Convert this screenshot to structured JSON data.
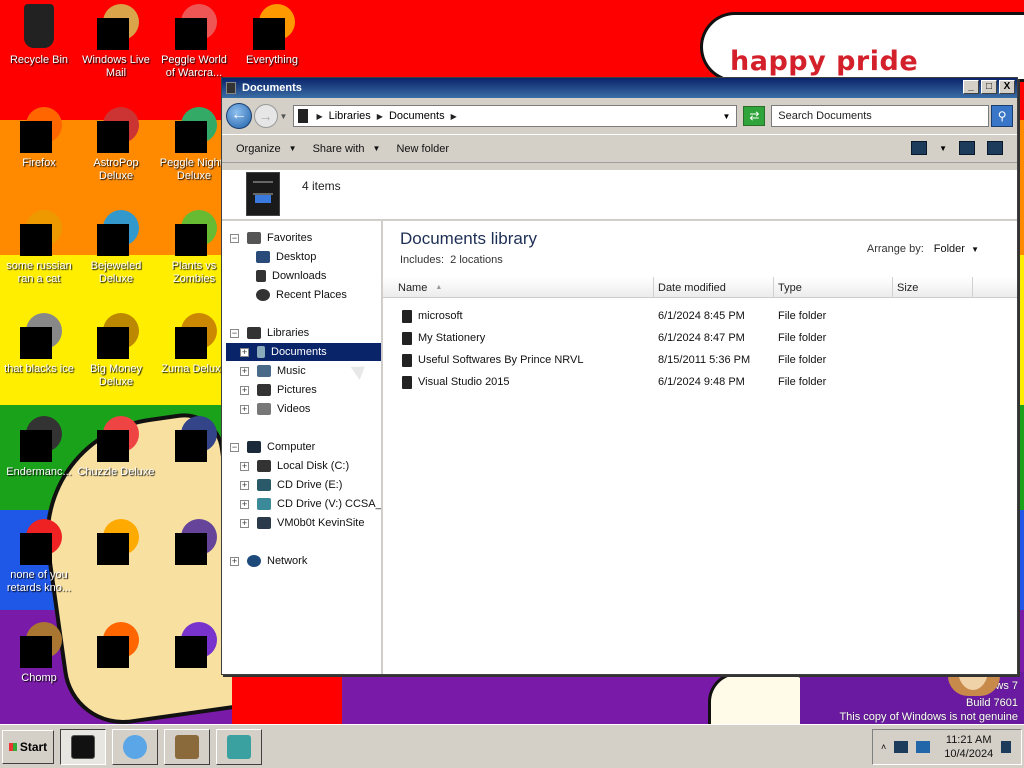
{
  "desktop": {
    "banner": "happy pride month",
    "watermark": {
      "line1": "ws 7",
      "line2": "Build 7601",
      "line3": "This copy of Windows is not genuine"
    },
    "stripe_colors": [
      "#ff0000",
      "#ff8a00",
      "#ffee00",
      "#1aa31a",
      "#1f57e6",
      "#7a1aa8"
    ],
    "icons": [
      {
        "label": "Recycle Bin",
        "icon": "recycle-bin-icon",
        "color": "#222"
      },
      {
        "label": "Windows Live Mail",
        "icon": "mail-icon",
        "color": "#d9a44a"
      },
      {
        "label": "Peggle World of Warcra...",
        "icon": "peggle-icon",
        "color": "#e55"
      },
      {
        "label": "Everything",
        "icon": "search-icon",
        "color": "#f90"
      },
      {
        "label": "Firefox",
        "icon": "firefox-icon",
        "color": "#f60"
      },
      {
        "label": "AstroPop Deluxe",
        "icon": "game-icon",
        "color": "#c33"
      },
      {
        "label": "Peggle Nights Deluxe",
        "icon": "peggle-icon",
        "color": "#3a6"
      },
      {
        "label": "some russian ran a cat",
        "icon": "app-icon",
        "color": "#e90"
      },
      {
        "label": "Bejeweled Deluxe",
        "icon": "gem-icon",
        "color": "#39c"
      },
      {
        "label": "Plants vs Zombies",
        "icon": "plant-icon",
        "color": "#6b3"
      },
      {
        "label": "that blacks ice",
        "icon": "app-icon",
        "color": "#888"
      },
      {
        "label": "Big Money Deluxe",
        "icon": "money-icon",
        "color": "#b80"
      },
      {
        "label": "Zuma Deluxe",
        "icon": "zuma-icon",
        "color": "#c80"
      },
      {
        "label": "Endermanc...",
        "icon": "app-icon",
        "color": "#333"
      },
      {
        "label": "Chuzzle Deluxe",
        "icon": "chuzzle-icon",
        "color": "#e44"
      },
      {
        "label": "",
        "icon": "app-icon",
        "color": "#348"
      },
      {
        "label": "none of you retards kno...",
        "icon": "app-icon",
        "color": "#e22"
      },
      {
        "label": "",
        "icon": "fish-icon",
        "color": "#fa0"
      },
      {
        "label": "",
        "icon": "app-icon",
        "color": "#649"
      },
      {
        "label": "Chomp",
        "icon": "hamster-icon",
        "color": "#a73"
      },
      {
        "label": "",
        "icon": "app-icon",
        "color": "#f60"
      },
      {
        "label": "",
        "icon": "visual-studio-icon",
        "color": "#73c"
      }
    ]
  },
  "window": {
    "title": "Documents",
    "controls": {
      "minimize": "_",
      "maximize": "□",
      "close": "X"
    },
    "address": {
      "crumbs": [
        "Libraries",
        "Documents"
      ]
    },
    "search": {
      "placeholder": "Search Documents"
    },
    "commands": {
      "organize": "Organize",
      "share_with": "Share with",
      "new_folder": "New folder"
    },
    "details": {
      "count": "4 items"
    },
    "nav": {
      "favorites": {
        "label": "Favorites",
        "items": [
          "Desktop",
          "Downloads",
          "Recent Places"
        ]
      },
      "libraries": {
        "label": "Libraries",
        "items": [
          "Documents",
          "Music",
          "Pictures",
          "Videos"
        ]
      },
      "computer": {
        "label": "Computer",
        "items": [
          "Local Disk (C:)",
          "CD Drive (E:)",
          "CD Drive (V:) CCSA_X",
          "VM0b0t KevinSite"
        ]
      },
      "network": {
        "label": "Network"
      }
    },
    "library": {
      "title": "Documents library",
      "includes_label": "Includes:",
      "includes_value": "2 locations",
      "arrange_label": "Arrange by:",
      "arrange_value": "Folder"
    },
    "columns": [
      "Name",
      "Date modified",
      "Type",
      "Size"
    ],
    "files": [
      {
        "name": "microsoft",
        "date": "6/1/2024 8:45 PM",
        "type": "File folder"
      },
      {
        "name": "My Stationery",
        "date": "6/1/2024 8:47 PM",
        "type": "File folder"
      },
      {
        "name": "Useful Softwares By Prince NRVL",
        "date": "8/15/2011 5:36 PM",
        "type": "File folder"
      },
      {
        "name": "Visual Studio 2015",
        "date": "6/1/2024 9:48 PM",
        "type": "File folder"
      }
    ]
  },
  "taskbar": {
    "start": "Start",
    "clock": {
      "time": "11:21 AM",
      "date": "10/4/2024"
    }
  }
}
